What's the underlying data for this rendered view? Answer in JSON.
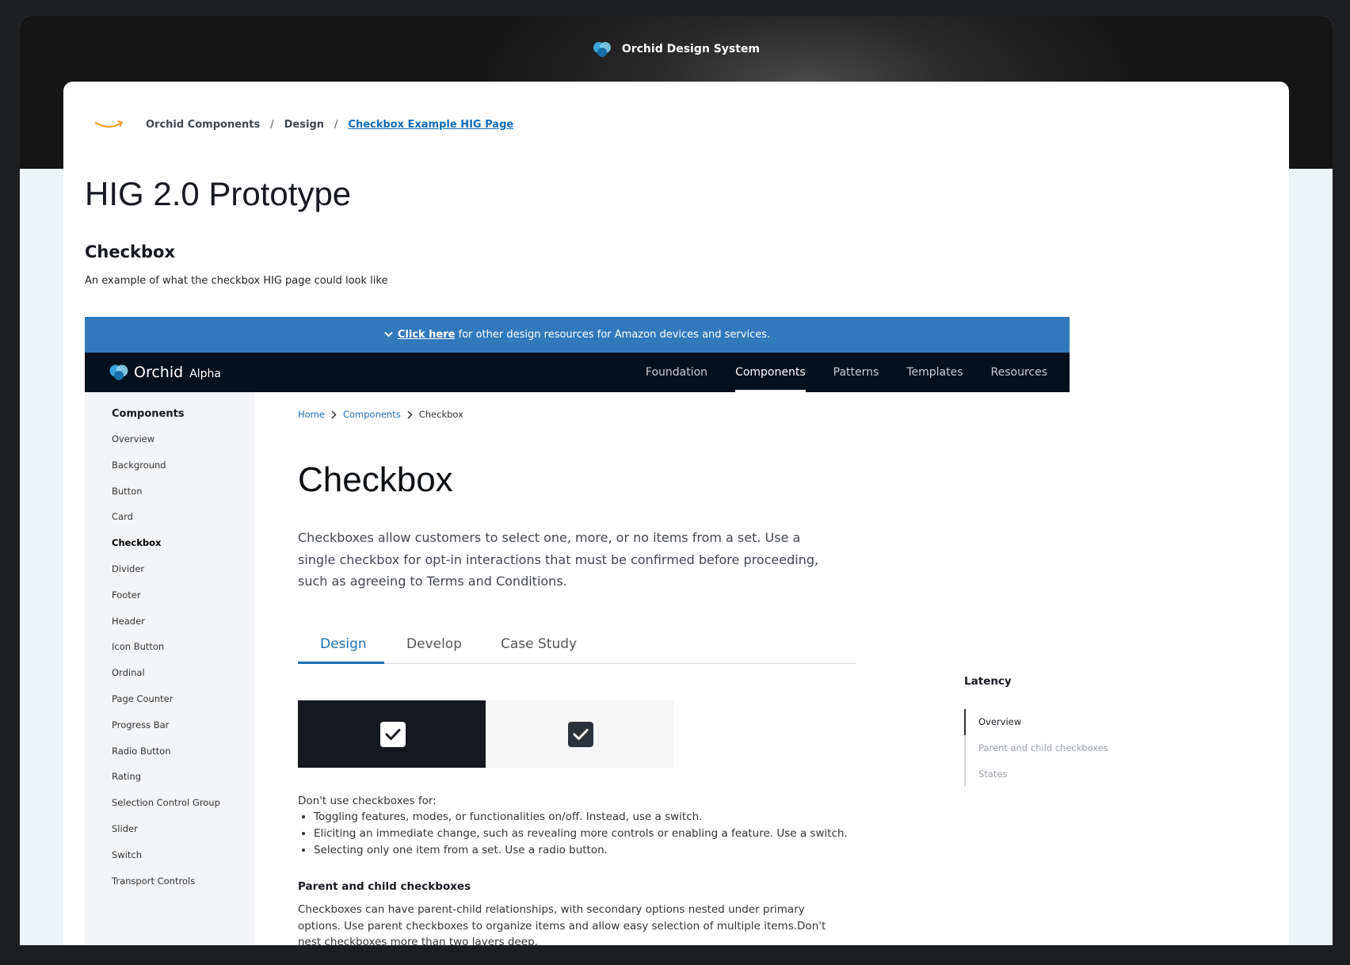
{
  "window": {
    "brand_title": "Orchid Design System"
  },
  "breadcrumb": {
    "items": [
      "Orchid Components",
      "Design"
    ],
    "current": "Checkbox Example HIG Page",
    "separator": "/"
  },
  "page": {
    "title": "HIG 2.0 Prototype",
    "section_title": "Checkbox",
    "lead": "An example of what the checkbox HIG page could look like"
  },
  "embed": {
    "banner": {
      "link": "Click here",
      "text": " for other design resources for Amazon devices and services."
    },
    "nav": {
      "logo_name": "Orchid",
      "logo_tag": "Alpha",
      "links": [
        "Foundation",
        "Components",
        "Patterns",
        "Templates",
        "Resources"
      ],
      "active": "Components"
    },
    "sidebar": {
      "title": "Components",
      "items": [
        "Overview",
        "Background",
        "Button",
        "Card",
        "Checkbox",
        "Divider",
        "Footer",
        "Header",
        "Icon Button",
        "Ordinal",
        "Page Counter",
        "Progress Bar",
        "Radio Button",
        "Rating",
        "Selection Control Group",
        "Slider",
        "Switch",
        "Transport Controls"
      ],
      "current": "Checkbox"
    },
    "content": {
      "breadcrumb": [
        "Home",
        "Components",
        "Checkbox"
      ],
      "heading": "Checkbox",
      "description": "Checkboxes allow customers to select one, more, or no items from a set. Use a single checkbox for opt-in interactions that must be confirmed before proceeding, such as agreeing to Terms and Conditions.",
      "tabs": [
        "Design",
        "Develop",
        "Case Study"
      ],
      "active_tab": "Design",
      "dont_title": "Don't use checkboxes for:",
      "dont_items": [
        "Toggling features, modes, or functionalities on/off. Instead, use a switch.",
        "Eliciting an immediate change, such as revealing more controls or enabling a feature. Use a switch.",
        "Selecting only one item from a set. Use a radio button."
      ],
      "parent_child_title": "Parent and child checkboxes",
      "parent_child_text": "Checkboxes can have parent-child relationships, with secondary options nested under primary options. Use parent checkboxes to organize items and allow easy selection of multiple items.Don't nest checkboxes more than two layers deep."
    },
    "toc": {
      "title": "Latency",
      "items": [
        "Overview",
        "Parent and child checkboxes",
        "States"
      ],
      "active": "Overview"
    }
  },
  "colors": {
    "banner": "#3179bb",
    "nav": "#03101e",
    "link": "#1c70b8",
    "brand_orange": "#f0a030"
  }
}
